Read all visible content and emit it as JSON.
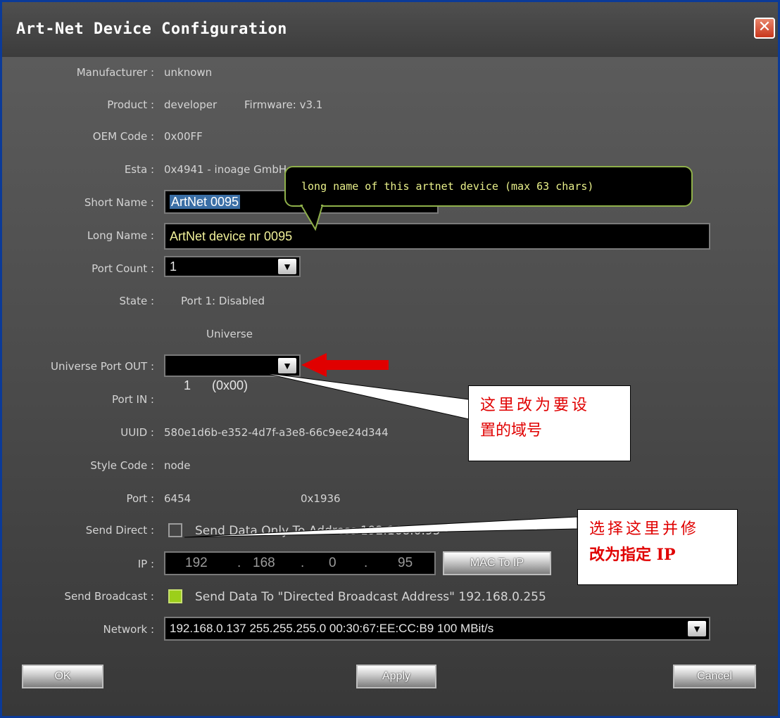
{
  "window": {
    "title": "Art-Net Device Configuration",
    "close_glyph": "✕"
  },
  "labels": {
    "manufacturer": "Manufacturer :",
    "product": "Product :",
    "oem": "OEM Code :",
    "esta": "Esta :",
    "short_name": "Short Name :",
    "long_name": "Long Name :",
    "port_count": "Port Count :",
    "state": "State :",
    "universe_port_out": "Universe Port OUT :",
    "port_in": "Port IN :",
    "uuid": "UUID :",
    "style_code": "Style Code :",
    "port": "Port :",
    "send_direct": "Send Direct :",
    "ip": "IP :",
    "send_broadcast": "Send Broadcast :",
    "network": "Network :"
  },
  "values": {
    "manufacturer": "unknown",
    "product": "developer",
    "firmware": "Firmware: v3.1",
    "oem": "0x00FF",
    "esta": "0x4941 - inoage GmbH",
    "short_name": "ArtNet 0095",
    "long_name": "ArtNet device nr 0095",
    "port_count": "1",
    "state": "Port 1: Disabled",
    "universe_header": "Universe",
    "universe_port_out": "1      (0x00)",
    "uuid": "580e1d6b-e352-4d7f-a3e8-66c9ee24d344",
    "style_code": "node",
    "port": "6454",
    "port_hex": "0x1936",
    "send_direct_text": "Send Data Only To Address 192.168.0.95",
    "send_direct_checked": false,
    "ip": {
      "o1": "192",
      "o2": "168",
      "o3": "0",
      "o4": "95",
      "dot": "."
    },
    "mac_to_ip_button": "MAC To IP",
    "send_broadcast_text": "Send Data To \"Directed Broadcast Address\" 192.168.0.255",
    "send_broadcast_checked": true,
    "network": "192.168.0.137  255.255.255.0  00:30:67:EE:CC:B9  100 MBit/s"
  },
  "tooltip": {
    "text": "long name of this artnet device (max 63 chars)"
  },
  "annotations": {
    "note1_line1": "这里改为要设",
    "note1_line2": "置的域号",
    "note2_line1": "选择这里并修",
    "note2_line2": "改为指定 IP"
  },
  "buttons": {
    "ok": "OK",
    "apply": "Apply",
    "cancel": "Cancel"
  },
  "colors": {
    "accent_check": "#9ccf1a",
    "tooltip_border": "#8fb04a",
    "annotation_red": "#e00000",
    "arrow_red": "#e00000"
  },
  "icons": {
    "combo_arrow": "chevron-down-icon",
    "close": "close-icon",
    "callout_arrow": "red-arrow-icon"
  }
}
